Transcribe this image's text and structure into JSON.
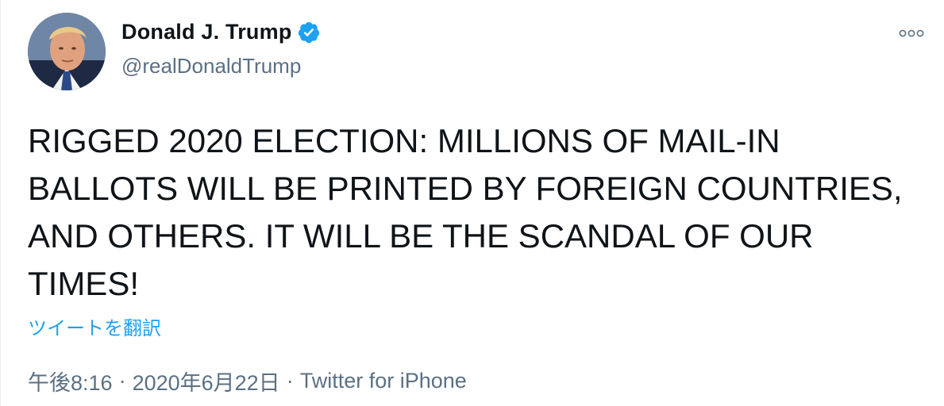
{
  "author": {
    "name": "Donald J. Trump",
    "handle": "@realDonaldTrump",
    "verified": true,
    "avatar_icon": "profile-photo"
  },
  "tweet": {
    "text": "RIGGED 2020 ELECTION: MILLIONS OF MAIL-IN BALLOTS WILL BE PRINTED BY FOREIGN COUNTRIES, AND OTHERS. IT WILL BE THE SCANDAL OF OUR TIMES!",
    "translate_label": "ツイートを翻訳"
  },
  "meta": {
    "time": "午後8:16",
    "date": "2020年6月22日",
    "source": "Twitter for iPhone",
    "separator": "·"
  },
  "more_icon": "more-options-icon",
  "colors": {
    "text": "#0f1419",
    "secondary": "#5b7083",
    "accent": "#1da1f2",
    "verified": "#1da1f2"
  }
}
